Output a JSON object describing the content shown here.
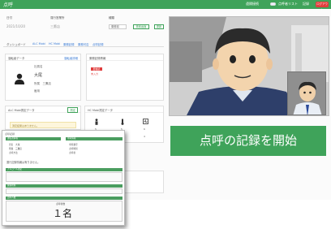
{
  "app": {
    "title": "点呼",
    "checkbox_labels": [
      "遠隔接続",
      "点呼者リスト",
      "記録"
    ],
    "logout_label": "ログアウト"
  },
  "filters": {
    "date_label": "日付",
    "date_value": "2021/10/20",
    "office_label": "運行営業所",
    "office_value": "三鷹店",
    "type_label": "種類",
    "type_value": "乗務前",
    "search_label": "検索画面",
    "refresh_label": "更新"
  },
  "tabs": [
    "ダッシュボード",
    "ALC Mobi",
    "HC Mobi",
    "乗務記録",
    "乗務可否",
    "点呼記録"
  ],
  "driver_panel": {
    "header": "運転者データ",
    "link": "運転者詳細",
    "fields": [
      "社員名",
      "大尾",
      "所属　三鷹店",
      "雇用"
    ]
  },
  "status_panel": {
    "header": "乗務記録情報",
    "badge": "要確認",
    "note": "未入力"
  },
  "alc_panel": {
    "header": "ALC Mobi測定データ",
    "button": "測定",
    "notice": "測定結果はありません。"
  },
  "hc_panel": {
    "header": "HC Mobi測定データ",
    "values": [
      "5",
      "5",
      "6",
      "4"
    ]
  },
  "start_button": "点呼の記録を開始",
  "report": {
    "doc_title": "点呼記録",
    "section_driver": "運転者情報",
    "section_vehicle": "車両情報",
    "driver_lines": [
      "氏名　大尾",
      "所属　三鷹店",
      "点呼方法"
    ],
    "vehicle_lines": [
      "車両番号",
      "点呼時刻",
      "点呼者"
    ],
    "message": "運行記録情報は有りません。",
    "section_alcohol": "アルコール測定",
    "section_health": "健康状態",
    "section_count": "点呼人数",
    "count_caption": "点呼者数",
    "count_value": "１名"
  },
  "colors": {
    "accent": "#3fa35a",
    "danger": "#e03c3c",
    "link": "#3a7bd5"
  }
}
